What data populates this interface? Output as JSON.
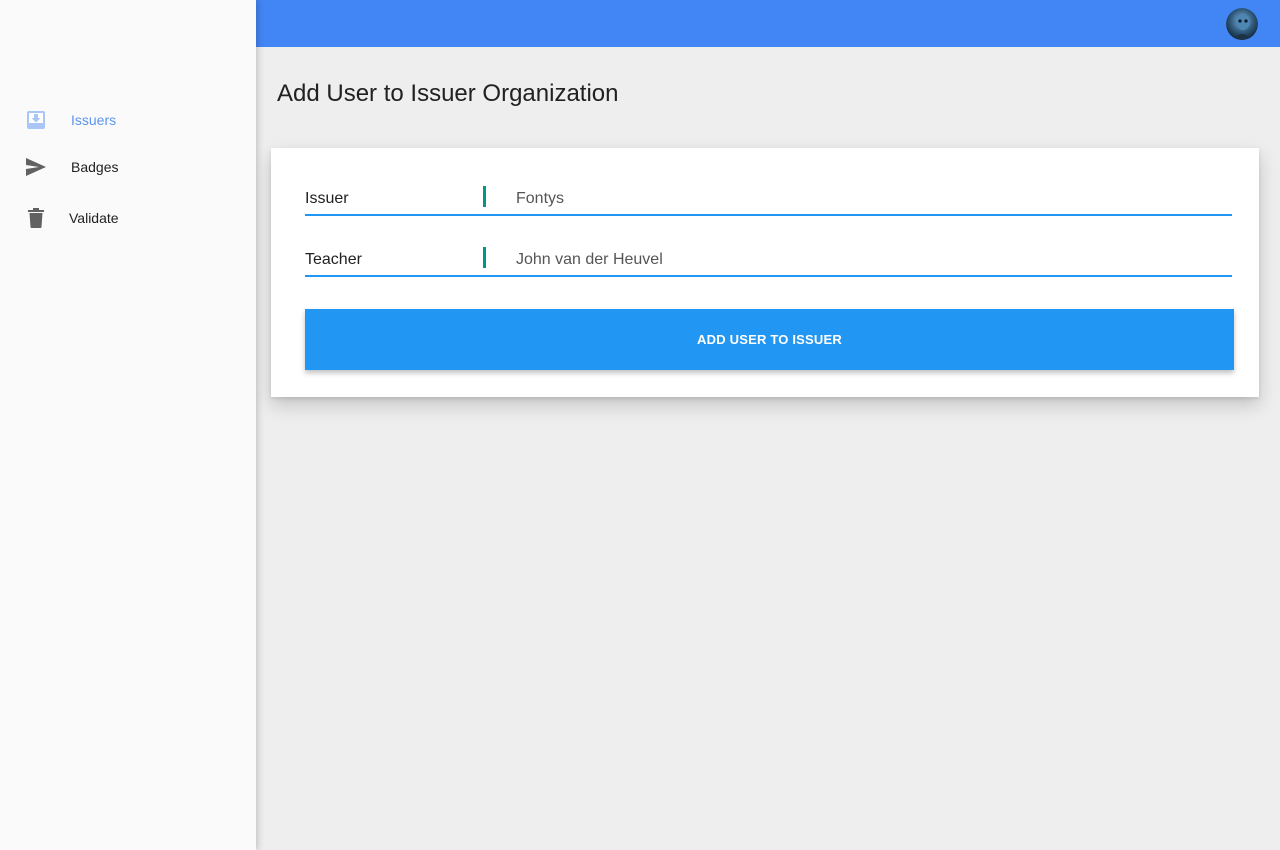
{
  "sidebar": {
    "items": [
      {
        "label": "Issuers",
        "icon": "move-to-inbox-icon",
        "active": true
      },
      {
        "label": "Badges",
        "icon": "send-icon",
        "active": false
      },
      {
        "label": "Validate",
        "icon": "trash-icon",
        "active": false
      }
    ]
  },
  "header": {
    "avatar_icon": "user-avatar"
  },
  "main": {
    "title": "Add User to Issuer Organization",
    "form": {
      "issuer_label": "Issuer",
      "issuer_value": "Fontys",
      "teacher_label": "Teacher",
      "teacher_value": "John van der Heuvel",
      "submit_label": "ADD USER TO ISSUER"
    }
  },
  "colors": {
    "topbar": "#4285f4",
    "primary": "#2196f3",
    "active_nav": "#5b95f0",
    "cursor": "#009688",
    "sidebar_bg": "#fafafa",
    "page_bg": "#eeeeee"
  }
}
